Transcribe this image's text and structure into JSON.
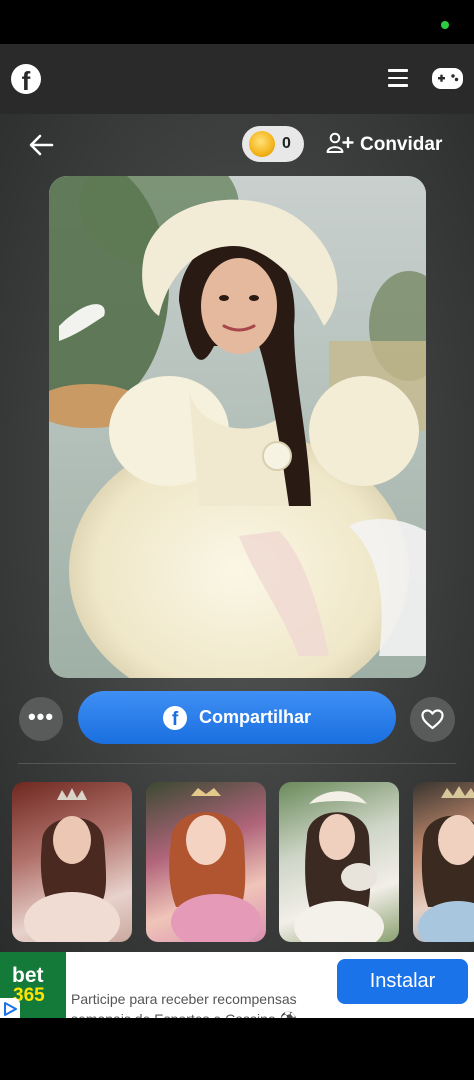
{
  "app": {
    "logo_letter": "f"
  },
  "topbar": {
    "coin_count": "0",
    "invite_label": "Convidar"
  },
  "actions": {
    "more_symbol": "•••",
    "share_label": "Compartilhar",
    "share_logo_letter": "f"
  },
  "gallery": {
    "thumbnails": [
      {
        "subject": "princess-with-tiara-ballroom"
      },
      {
        "subject": "red-haired-princess-pink-dress"
      },
      {
        "subject": "princess-with-cat-garden"
      },
      {
        "subject": "princess-with-tiara-blue-dress"
      }
    ]
  },
  "ad": {
    "brand_top": "bet",
    "brand_bottom": "365",
    "text": "Participe para receber recompensas semanais de Esportes e Cassino ⚽",
    "install_label": "Instalar"
  },
  "colors": {
    "share_button": "#1a6fe0",
    "install_button": "#1a73e8",
    "status_dot": "#2ecc40",
    "ad_brand": "#137a3a"
  }
}
